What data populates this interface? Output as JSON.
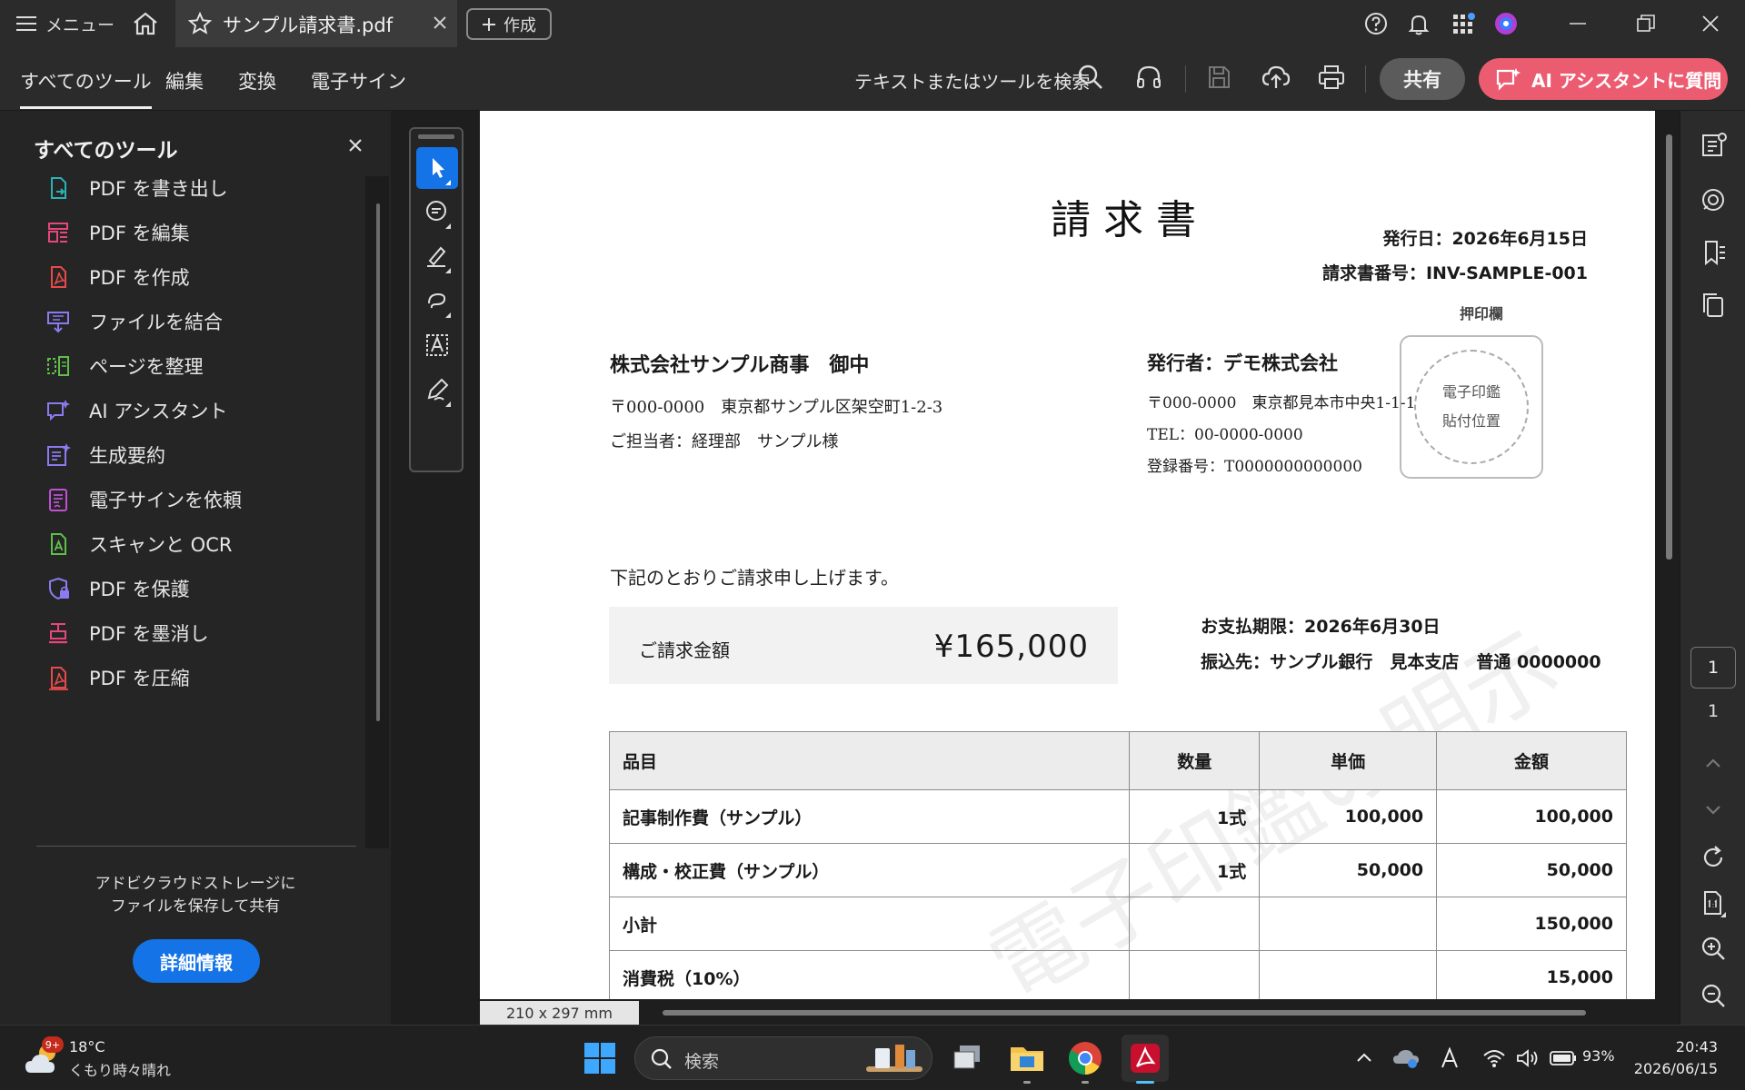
{
  "titlebar": {
    "menu_label": "メニュー",
    "tab_title": "サンプル請求書.pdf",
    "new_label": "作成"
  },
  "toolbar": {
    "tabs": [
      "すべてのツール",
      "編集",
      "変換",
      "電子サイン"
    ],
    "search_label": "テキストまたはツールを検索",
    "share_label": "共有",
    "ai_label": "AI アシスタントに質問"
  },
  "left_panel": {
    "title": "すべてのツール",
    "tools": [
      {
        "label": "PDF を書き出し",
        "icon": "export-pdf-icon",
        "color": "#2ab3b3"
      },
      {
        "label": "PDF を編集",
        "icon": "edit-pdf-icon",
        "color": "#e8467c"
      },
      {
        "label": "PDF を作成",
        "icon": "create-pdf-icon",
        "color": "#e84a4a"
      },
      {
        "label": "ファイルを結合",
        "icon": "combine-files-icon",
        "color": "#8a7bf0"
      },
      {
        "label": "ページを整理",
        "icon": "organize-pages-icon",
        "color": "#5fbf4a"
      },
      {
        "label": "AI アシスタント",
        "icon": "ai-assistant-icon",
        "color": "#8a7bf0"
      },
      {
        "label": "生成要約",
        "icon": "generative-summary-icon",
        "color": "#8a7bf0"
      },
      {
        "label": "電子サインを依頼",
        "icon": "request-esign-icon",
        "color": "#c24fd6"
      },
      {
        "label": "スキャンと OCR",
        "icon": "scan-ocr-icon",
        "color": "#5fbf4a"
      },
      {
        "label": "PDF を保護",
        "icon": "protect-pdf-icon",
        "color": "#8a7bf0"
      },
      {
        "label": "PDF を墨消し",
        "icon": "redact-pdf-icon",
        "color": "#e8467c"
      },
      {
        "label": "PDF を圧縮",
        "icon": "compress-pdf-icon",
        "color": "#e84a4a"
      }
    ],
    "storage_note_line1": "アドビクラウドストレージに",
    "storage_note_line2": "ファイルを保存して共有",
    "more_info_label": "詳細情報"
  },
  "document": {
    "title": "請求書",
    "issue_date": "発行日：2026年6月15日",
    "invoice_no": "請求書番号：INV-SAMPLE-001",
    "stamp_label": "押印欄",
    "stamp_line1": "電子印鑑",
    "stamp_line2": "貼付位置",
    "to_name": "株式会社サンプル商事　御中",
    "to_address": "〒000-0000　東京都サンプル区架空町1-2-3",
    "to_contact": "ご担当者：経理部　サンプル様",
    "from_name": "発行者：デモ株式会社",
    "from_address": "〒000-0000　東京都見本市中央1-1-1",
    "from_tel": "TEL：00-0000-0000",
    "from_reg": "登録番号：T0000000000000",
    "intro": "下記のとおりご請求申し上げます。",
    "amount_label": "ご請求金額",
    "amount_value": "¥165,000",
    "due_date": "お支払期限：2026年6月30日",
    "bank": "振込先：サンプル銀行　見本支店　普通 0000000",
    "watermark": "電子印鑑の明示",
    "table": {
      "headers": [
        "品目",
        "数量",
        "単価",
        "金額"
      ],
      "rows": [
        [
          "記事制作費（サンプル）",
          "1式",
          "100,000",
          "100,000"
        ],
        [
          "構成・校正費（サンプル）",
          "1式",
          "50,000",
          "50,000"
        ],
        [
          "小計",
          "",
          "",
          "150,000"
        ],
        [
          "消費税（10%）",
          "",
          "",
          "15,000"
        ]
      ]
    }
  },
  "page_size_label": "210 x 297 mm",
  "right_rail": {
    "current_page": "1",
    "total_pages": "1"
  },
  "taskbar": {
    "weather_temp": "18°C",
    "weather_cond": "くもり時々晴れ",
    "weather_badge": "9+",
    "search_label": "検索",
    "battery": "93%",
    "time": "20:43",
    "date": "2026/06/15"
  }
}
